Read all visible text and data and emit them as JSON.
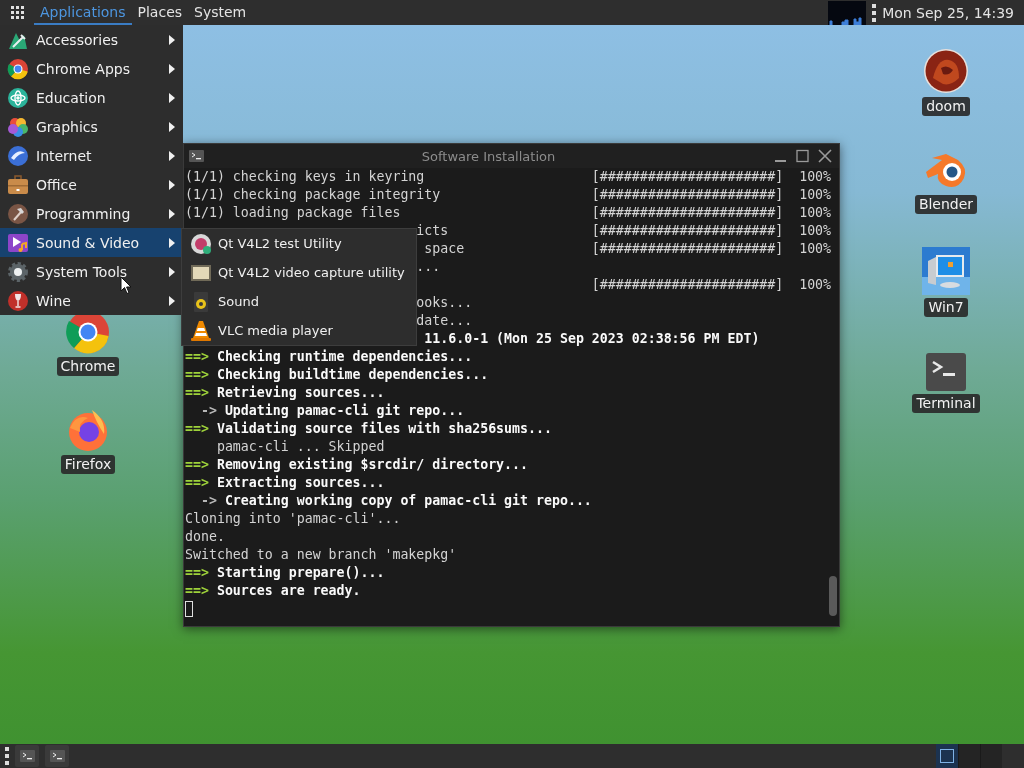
{
  "top_panel": {
    "menus": [
      {
        "label": "Applications",
        "selected": true
      },
      {
        "label": "Places",
        "selected": false
      },
      {
        "label": "System",
        "selected": false
      }
    ],
    "clock": "Mon Sep 25, 14:39"
  },
  "applications_menu": {
    "items": [
      {
        "label": "Accessories",
        "selected": false
      },
      {
        "label": "Chrome Apps",
        "selected": false
      },
      {
        "label": "Education",
        "selected": false
      },
      {
        "label": "Graphics",
        "selected": false
      },
      {
        "label": "Internet",
        "selected": false
      },
      {
        "label": "Office",
        "selected": false
      },
      {
        "label": "Programming",
        "selected": false
      },
      {
        "label": "Sound & Video",
        "selected": true
      },
      {
        "label": "System Tools",
        "selected": false
      },
      {
        "label": "Wine",
        "selected": false
      }
    ]
  },
  "submenu": {
    "items": [
      {
        "label": "Qt V4L2 test Utility"
      },
      {
        "label": "Qt V4L2 video capture utility"
      },
      {
        "label": "Sound"
      },
      {
        "label": "VLC media player"
      }
    ]
  },
  "desktop_icons": [
    {
      "label": "doom"
    },
    {
      "label": "Blender"
    },
    {
      "label": "Win7"
    },
    {
      "label": "Chrome"
    },
    {
      "label": "Terminal"
    },
    {
      "label": "Firefox"
    }
  ],
  "terminal": {
    "title": "Software Installation",
    "lines": [
      {
        "kind": "output",
        "text": "(1/1) checking keys in keyring",
        "progress": "[######################]",
        "percent": "100%"
      },
      {
        "kind": "output",
        "text": "(1/1) checking package integrity",
        "progress": "[######################]",
        "percent": "100%"
      },
      {
        "kind": "output",
        "text": "(1/1) loading package files",
        "progress": "[######################]",
        "percent": "100%"
      },
      {
        "kind": "output",
        "text": "                             icts",
        "progress": "[######################]",
        "percent": "100%"
      },
      {
        "kind": "output",
        "text": "                              space",
        "progress": "[######################]",
        "percent": "100%"
      },
      {
        "kind": "output",
        "text": "                             ..."
      },
      {
        "kind": "output",
        "progress": "[######################]",
        "percent": "100%"
      },
      {
        "kind": "output",
        "text": "                             ooks..."
      },
      {
        "kind": "output",
        "text": "                             date..."
      },
      {
        "kind": "step",
        "text": "                              11.6.0-1 (Mon 25 Sep 2023 02:38:56 PM EDT)"
      },
      {
        "kind": "step",
        "marker": "==>",
        "text": "Checking runtime dependencies..."
      },
      {
        "kind": "step",
        "marker": "==>",
        "text": "Checking buildtime dependencies..."
      },
      {
        "kind": "step",
        "marker": "==>",
        "text": "Retrieving sources..."
      },
      {
        "kind": "substep",
        "marker": "->",
        "text": "Updating pamac-cli git repo..."
      },
      {
        "kind": "step",
        "marker": "==>",
        "text": "Validating source files with sha256sums..."
      },
      {
        "kind": "output",
        "text": "    pamac-cli ... Skipped"
      },
      {
        "kind": "step",
        "marker": "==>",
        "text": "Removing existing $srcdir/ directory..."
      },
      {
        "kind": "step",
        "marker": "==>",
        "text": "Extracting sources..."
      },
      {
        "kind": "substep",
        "marker": "->",
        "text": "Creating working copy of pamac-cli git repo..."
      },
      {
        "kind": "output",
        "text": "Cloning into 'pamac-cli'..."
      },
      {
        "kind": "output",
        "text": "done."
      },
      {
        "kind": "output",
        "text": "Switched to a new branch 'makepkg'"
      },
      {
        "kind": "step",
        "marker": "==>",
        "text": "Starting prepare()..."
      },
      {
        "kind": "step",
        "marker": "==>",
        "text": "Sources are ready."
      }
    ]
  },
  "workspaces": [
    {
      "selected": true
    },
    {
      "selected": false
    },
    {
      "selected": false
    }
  ]
}
